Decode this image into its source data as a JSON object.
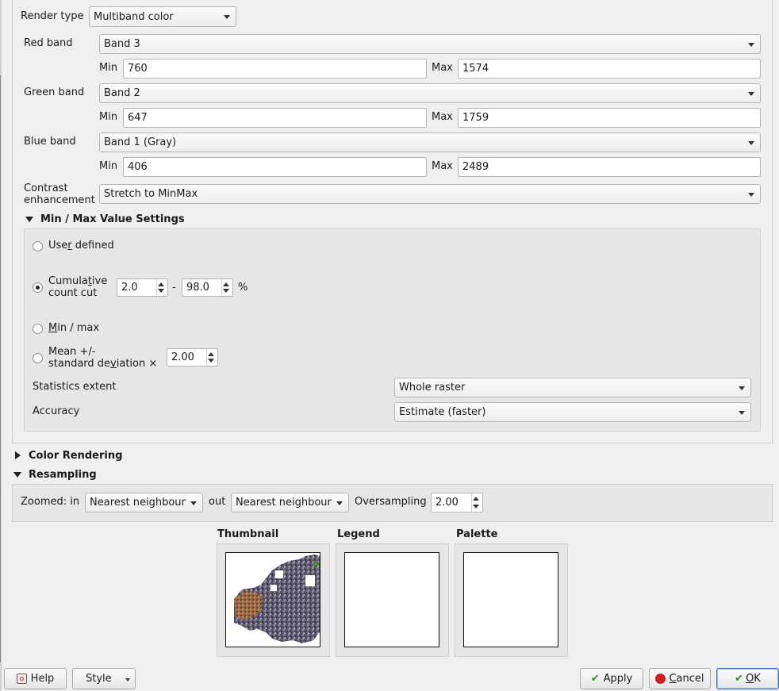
{
  "render_type": {
    "label": "Render type",
    "value": "Multiband color"
  },
  "red_band": {
    "label": "Red band",
    "value": "Band 3",
    "min_label": "Min",
    "min": "760",
    "max_label": "Max",
    "max": "1574"
  },
  "green_band": {
    "label": "Green band",
    "value": "Band 2",
    "min_label": "Min",
    "min": "647",
    "max_label": "Max",
    "max": "1759"
  },
  "blue_band": {
    "label": "Blue band",
    "value": "Band 1 (Gray)",
    "min_label": "Min",
    "min": "406",
    "max_label": "Max",
    "max": "2489"
  },
  "contrast": {
    "label_line1": "Contrast",
    "label_line2": "enhancement",
    "value": "Stretch to MinMax"
  },
  "minmax_settings": {
    "title": "Min / Max Value Settings",
    "user_defined": {
      "pre": "Use",
      "ul": "r",
      "post": " defined",
      "checked": false
    },
    "cumulative": {
      "line1_pre": "Cumula",
      "line1_ul": "t",
      "line1_post": "ive",
      "line2": "count cut",
      "checked": true,
      "low": "2.0",
      "dash": "-",
      "high": "98.0",
      "unit": "%"
    },
    "min_max": {
      "ul": "M",
      "post": "in / max",
      "checked": false
    },
    "mean_std": {
      "line1": "Mean +/-",
      "line2_pre": "standard de",
      "line2_ul": "v",
      "line2_post": "iation ×",
      "checked": false,
      "value": "2.00"
    },
    "stats_extent": {
      "label": "Statistics extent",
      "value": "Whole raster"
    },
    "accuracy": {
      "label": "Accuracy",
      "value": "Estimate (faster)"
    }
  },
  "color_rendering": {
    "title": "Color Rendering",
    "expanded": false
  },
  "resampling": {
    "title": "Resampling",
    "expanded": true,
    "zoomed_in_label": "Zoomed: in",
    "zoomed_in_value": "Nearest neighbour",
    "out_label": "out",
    "out_value": "Nearest neighbour",
    "oversampling_label": "Oversampling",
    "oversampling_value": "2.00"
  },
  "previews": {
    "thumbnail": "Thumbnail",
    "legend": "Legend",
    "palette": "Palette"
  },
  "buttons": {
    "help": "Help",
    "style": "Style",
    "apply": "Apply",
    "cancel_ul": "C",
    "cancel_post": "ancel",
    "ok_ul": "O",
    "ok_post": "K"
  },
  "colors": {
    "accent": "#3d74c0",
    "cancel_icon": "#d11f1f",
    "apply_check": "#2e8b2e"
  }
}
